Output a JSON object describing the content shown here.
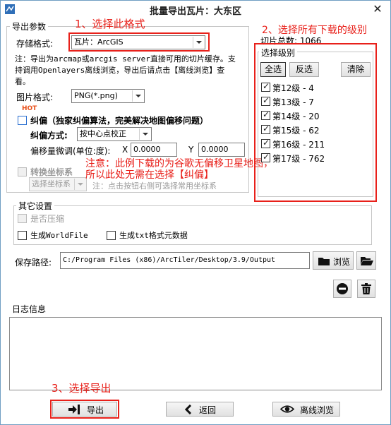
{
  "window": {
    "title": "批量导出瓦片：大东区"
  },
  "annotations": {
    "step1": "1、选择此格式",
    "step2": "2、选择所有下载的级别",
    "step3": "3、选择导出",
    "note_line1": "注意：此例下载的为谷歌无偏移卫星地图，",
    "note_line2": "所以此处无需在选择【纠偏】"
  },
  "export_params": {
    "group_title": "导出参数",
    "storage_format_label": "存储格式:",
    "storage_format_value": "瓦片：ArcGIS",
    "note_line1": "注：导出为arcmap或arcgis server直接可用的切片缓存。支",
    "note_line2": "持调用Openlayers离线浏览，导出后请点击【离线浏览】查",
    "note_line3": "看。",
    "image_format_label": "图片格式:",
    "image_format_value": "PNG(*.png)",
    "hot_badge": "HOT",
    "rectify_label": "纠偏（独家纠偏算法，完美解决地图偏移问题）",
    "rectify_method_label": "纠偏方式:",
    "rectify_method_value": "按中心点校正",
    "offset_label": "偏移量微调(单位:度):",
    "x_label": "X",
    "x_value": "0.0000",
    "y_label": "Y",
    "y_value": "0.0000",
    "convert_label": "转换坐标系",
    "convert_select_placeholder": "选择坐标系",
    "convert_hint": "注：点击按钮右侧可选择常用坐标系"
  },
  "level_panel": {
    "total_label": "切片总数:",
    "total_value": "1066",
    "group_title": "选择级别",
    "select_all": "全选",
    "invert": "反选",
    "clear": "清除",
    "levels": [
      {
        "label": "第12级 - 4",
        "checked": true
      },
      {
        "label": "第13级 - 7",
        "checked": true
      },
      {
        "label": "第14级 - 20",
        "checked": true
      },
      {
        "label": "第15级 - 62",
        "checked": true
      },
      {
        "label": "第16级 - 211",
        "checked": true
      },
      {
        "label": "第17级 - 762",
        "checked": true
      }
    ]
  },
  "other_settings": {
    "group_title": "其它设置",
    "compress_label": "是否压缩",
    "worldfile_label": "生成WorldFile",
    "txt_meta_label": "生成txt格式元数据"
  },
  "save": {
    "label": "保存路径:",
    "path": "C:/Program Files (x86)/ArcTiler/Desktop/3.9/Output",
    "browse": "浏览"
  },
  "log": {
    "group_title": "日志信息"
  },
  "footer": {
    "export": "导出",
    "back": "返回",
    "offline_view": "离线浏览"
  }
}
